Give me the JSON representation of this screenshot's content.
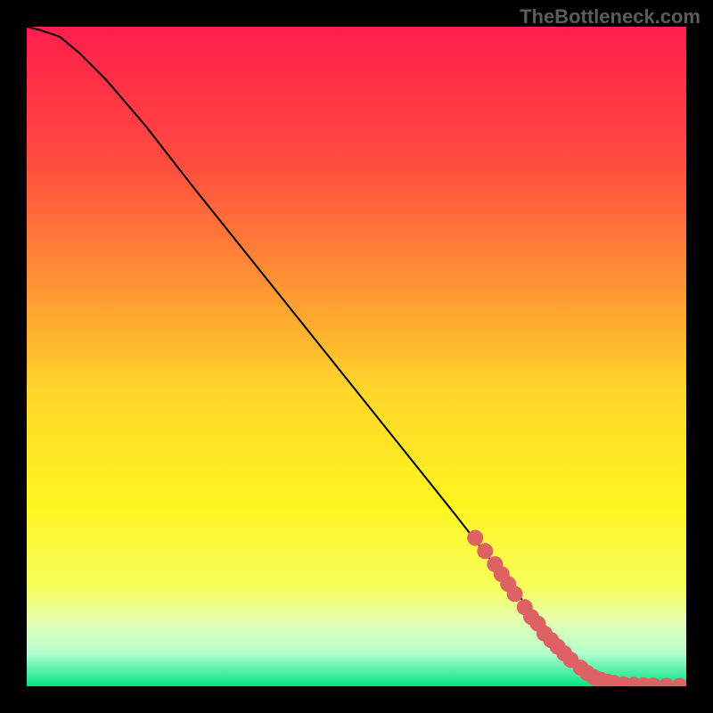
{
  "watermark": "TheBottleneck.com",
  "chart_data": {
    "type": "line",
    "title": "",
    "xlabel": "",
    "ylabel": "",
    "xlim": [
      0,
      100
    ],
    "ylim": [
      0,
      100
    ],
    "grid": false,
    "legend": false,
    "background_gradient": {
      "stops": [
        {
          "pos": 0.0,
          "color": "#ff1f4b"
        },
        {
          "pos": 0.2,
          "color": "#ff4a3f"
        },
        {
          "pos": 0.4,
          "color": "#ff9733"
        },
        {
          "pos": 0.55,
          "color": "#ffd52a"
        },
        {
          "pos": 0.72,
          "color": "#fff41f"
        },
        {
          "pos": 0.85,
          "color": "#f7ff5b"
        },
        {
          "pos": 0.9,
          "color": "#e6ffb0"
        },
        {
          "pos": 0.95,
          "color": "#b3ffd0"
        },
        {
          "pos": 1.0,
          "color": "#00e383"
        }
      ]
    },
    "series": [
      {
        "name": "curve",
        "type": "line",
        "color": "#000000",
        "stroke_width": 2,
        "x": [
          0,
          2,
          5,
          8,
          12,
          18,
          25,
          35,
          45,
          55,
          65,
          72,
          78,
          82,
          85,
          88,
          91,
          94,
          97,
          100
        ],
        "y": [
          100,
          99.5,
          98.5,
          96,
          92,
          85,
          76,
          63.5,
          51,
          38.5,
          26,
          17,
          9.5,
          4.5,
          1.5,
          0.4,
          0.1,
          0.05,
          0.03,
          0.02
        ]
      },
      {
        "name": "dots",
        "type": "scatter",
        "color": "#de6164",
        "marker_size": 9,
        "x": [
          68,
          69.5,
          71,
          72,
          73,
          74,
          75.5,
          76.5,
          77.5,
          78.5,
          79.5,
          80.5,
          81.5,
          82.5,
          84,
          85,
          86,
          87,
          88,
          89,
          90.5,
          92,
          93.5,
          95,
          97,
          99
        ],
        "y": [
          22.5,
          20.5,
          18.5,
          17,
          15.5,
          14,
          12,
          10.5,
          9.5,
          8,
          7,
          6,
          5,
          4,
          2.8,
          2,
          1.4,
          1,
          0.7,
          0.5,
          0.3,
          0.2,
          0.15,
          0.1,
          0.07,
          0.05
        ]
      }
    ]
  }
}
